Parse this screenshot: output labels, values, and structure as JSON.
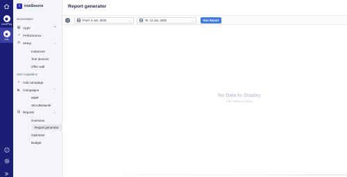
{
  "rail": {
    "levelplay_label": "LevelPlay",
    "ads_label": "Ads"
  },
  "sidebar": {
    "logo_text": "ironSource",
    "monetization_title": "Monetization",
    "apps": "Apps",
    "apps_plus": "+",
    "performance": "Performance",
    "setup": "Setup",
    "instances": "Instances",
    "test_devices": "Test devices",
    "offer_wall": "Offer wall",
    "ua_title": "User Acquisition",
    "add_campaign": "Add campaign",
    "add_plus": "+",
    "campaigns": "Campaigns",
    "mmp": "MMP",
    "skadnetwork": "SKAdNetwork",
    "reports": "Reports",
    "overview": "Overview",
    "report_generator": "Report generator",
    "optimizer": "Optimizer",
    "budget": "Budget"
  },
  "main": {
    "title": "Report generator",
    "date_from": "From: 5 Jun, 2025",
    "date_to": "To: 12 Jun, 2025",
    "run_report": "Run Report",
    "empty_title": "No Data to Display",
    "empty_sub": "Add metrics to begin"
  },
  "colors": {
    "rail": "#1a1e74",
    "accent": "#3d7be8"
  }
}
